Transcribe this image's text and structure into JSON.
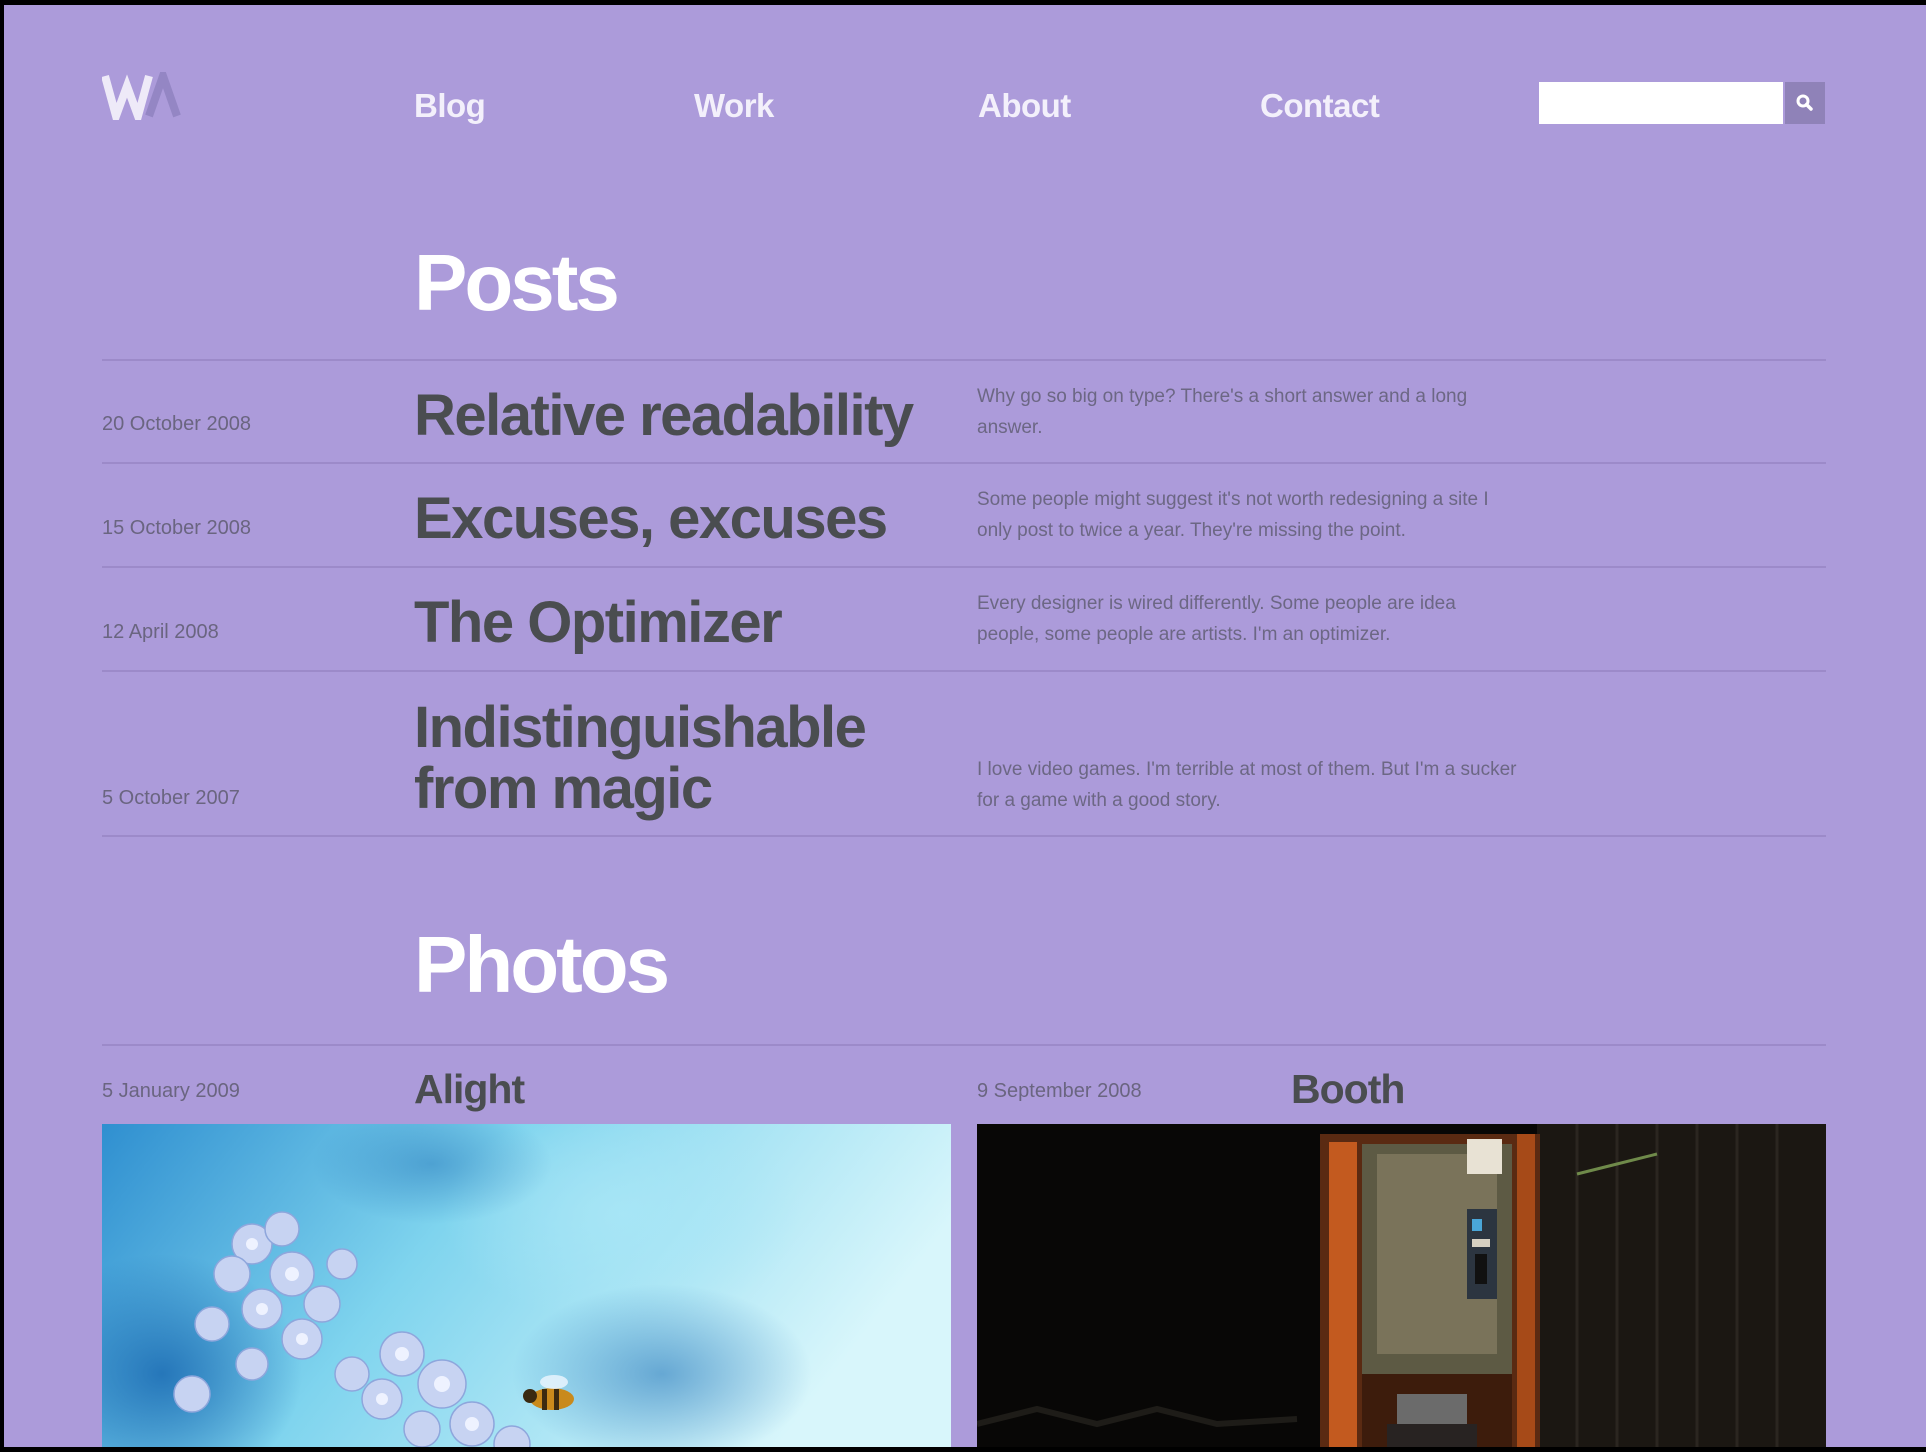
{
  "header": {
    "logo_text": "WA",
    "nav": [
      {
        "label": "Blog"
      },
      {
        "label": "Work"
      },
      {
        "label": "About"
      },
      {
        "label": "Contact"
      }
    ],
    "search": {
      "value": "",
      "placeholder": ""
    }
  },
  "posts": {
    "title": "Posts",
    "items": [
      {
        "date": "20 October 2008",
        "title": "Relative readability",
        "summary": "Why go so big on type? There's a short answer and a long answer."
      },
      {
        "date": "15 October 2008",
        "title": "Excuses, excuses",
        "summary": "Some people might suggest it's not worth redesigning a site I only post to twice a year. They're missing the point."
      },
      {
        "date": "12 April 2008",
        "title": "The Optimizer",
        "summary": "Every designer is wired differently. Some people are idea people, some people are artists. I'm an optimizer."
      },
      {
        "date": "5 October 2007",
        "title": "Indistinguishable from magic",
        "summary": "I love video games. I'm terrible at most of them. But I'm a sucker for a game with a good story."
      }
    ]
  },
  "photos": {
    "title": "Photos",
    "items": [
      {
        "date": "5 January 2009",
        "title": "Alight"
      },
      {
        "date": "9 September 2008",
        "title": "Booth"
      }
    ]
  },
  "colors": {
    "background": "#ac9bda",
    "nav_text": "#f3f0fb",
    "heading": "#ffffff",
    "post_title": "#4a4d50",
    "meta_text": "#6a6580",
    "rule": "#9c8ac9"
  }
}
